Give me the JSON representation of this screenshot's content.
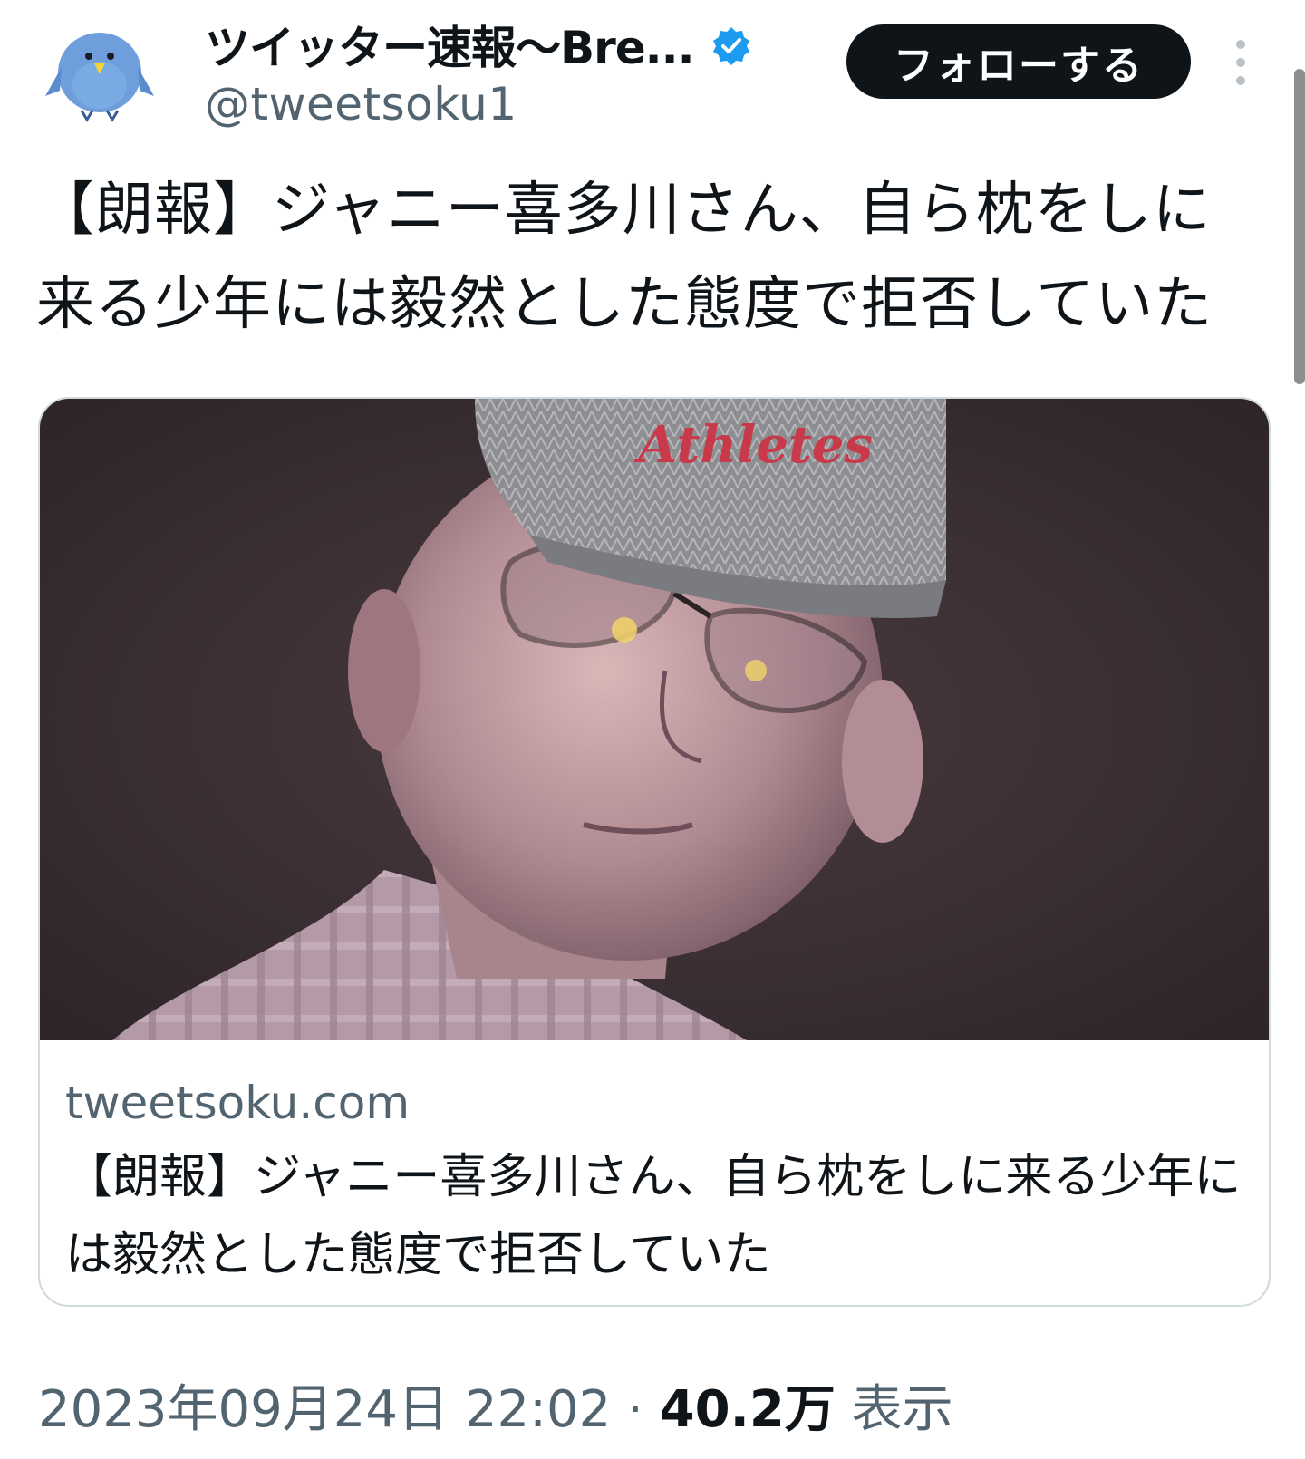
{
  "header": {
    "display_name": "ツイッター速報〜Bre...",
    "handle": "@tweetsoku1",
    "follow_label": "フォローする",
    "verified": true
  },
  "tweet": {
    "text": "【朗報】ジャニー喜多川さん、自ら枕をしに来る少年には毅然とした態度で拒否していた"
  },
  "card": {
    "domain": "tweetsoku.com",
    "title": "【朗報】ジャニー喜多川さん、自ら枕をしに来る少年には毅然とした態度で拒否していた",
    "image_text": "Athletes"
  },
  "meta": {
    "datetime": "2023年09月24日 22:02",
    "separator": "·",
    "views_count": "40.2万",
    "views_label": "表示"
  },
  "colors": {
    "verified_blue": "#1d9bf0",
    "follow_bg": "#0f1419",
    "muted": "#536471",
    "border": "#cfd9de"
  },
  "icons": {
    "avatar": "blue-bird-avatar-icon",
    "verified": "verified-badge-icon",
    "more": "more-vertical-icon"
  }
}
